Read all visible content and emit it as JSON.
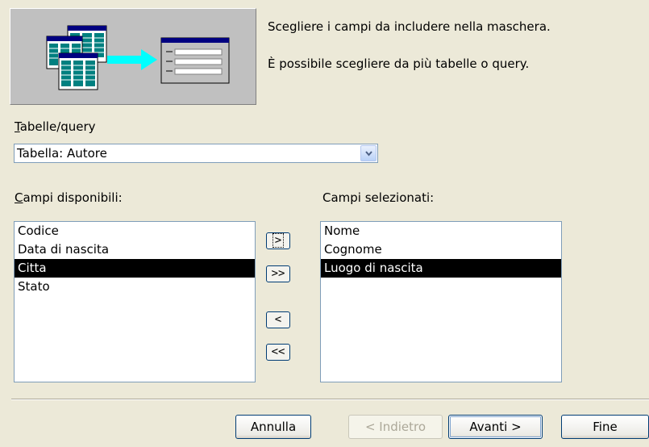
{
  "description": {
    "line1": "Scegliere i campi da includere nella maschera.",
    "line2": "È possibile scegliere da più tabelle o query."
  },
  "tables_query": {
    "label": "Tabelle/query",
    "value": "Tabella: Autore"
  },
  "available_fields": {
    "label": "Campi disponibili:",
    "items": [
      "Codice",
      "Data di nascita",
      "Citta",
      "Stato"
    ],
    "selected_index": 2
  },
  "selected_fields": {
    "label": "Campi selezionati:",
    "items": [
      "Nome",
      "Cognome",
      "Luogo di nascita"
    ],
    "selected_index": 2
  },
  "move_buttons": {
    "add_one": ">",
    "add_all": ">>",
    "remove_one": "<",
    "remove_all": "<<"
  },
  "footer_buttons": {
    "cancel": "Annulla",
    "back": "< Indietro",
    "next": "Avanti >",
    "finish": "Fine"
  },
  "colors": {
    "dialog_bg": "#ece9d8",
    "selection_bg": "#000000",
    "list_border": "#7f9db9"
  }
}
